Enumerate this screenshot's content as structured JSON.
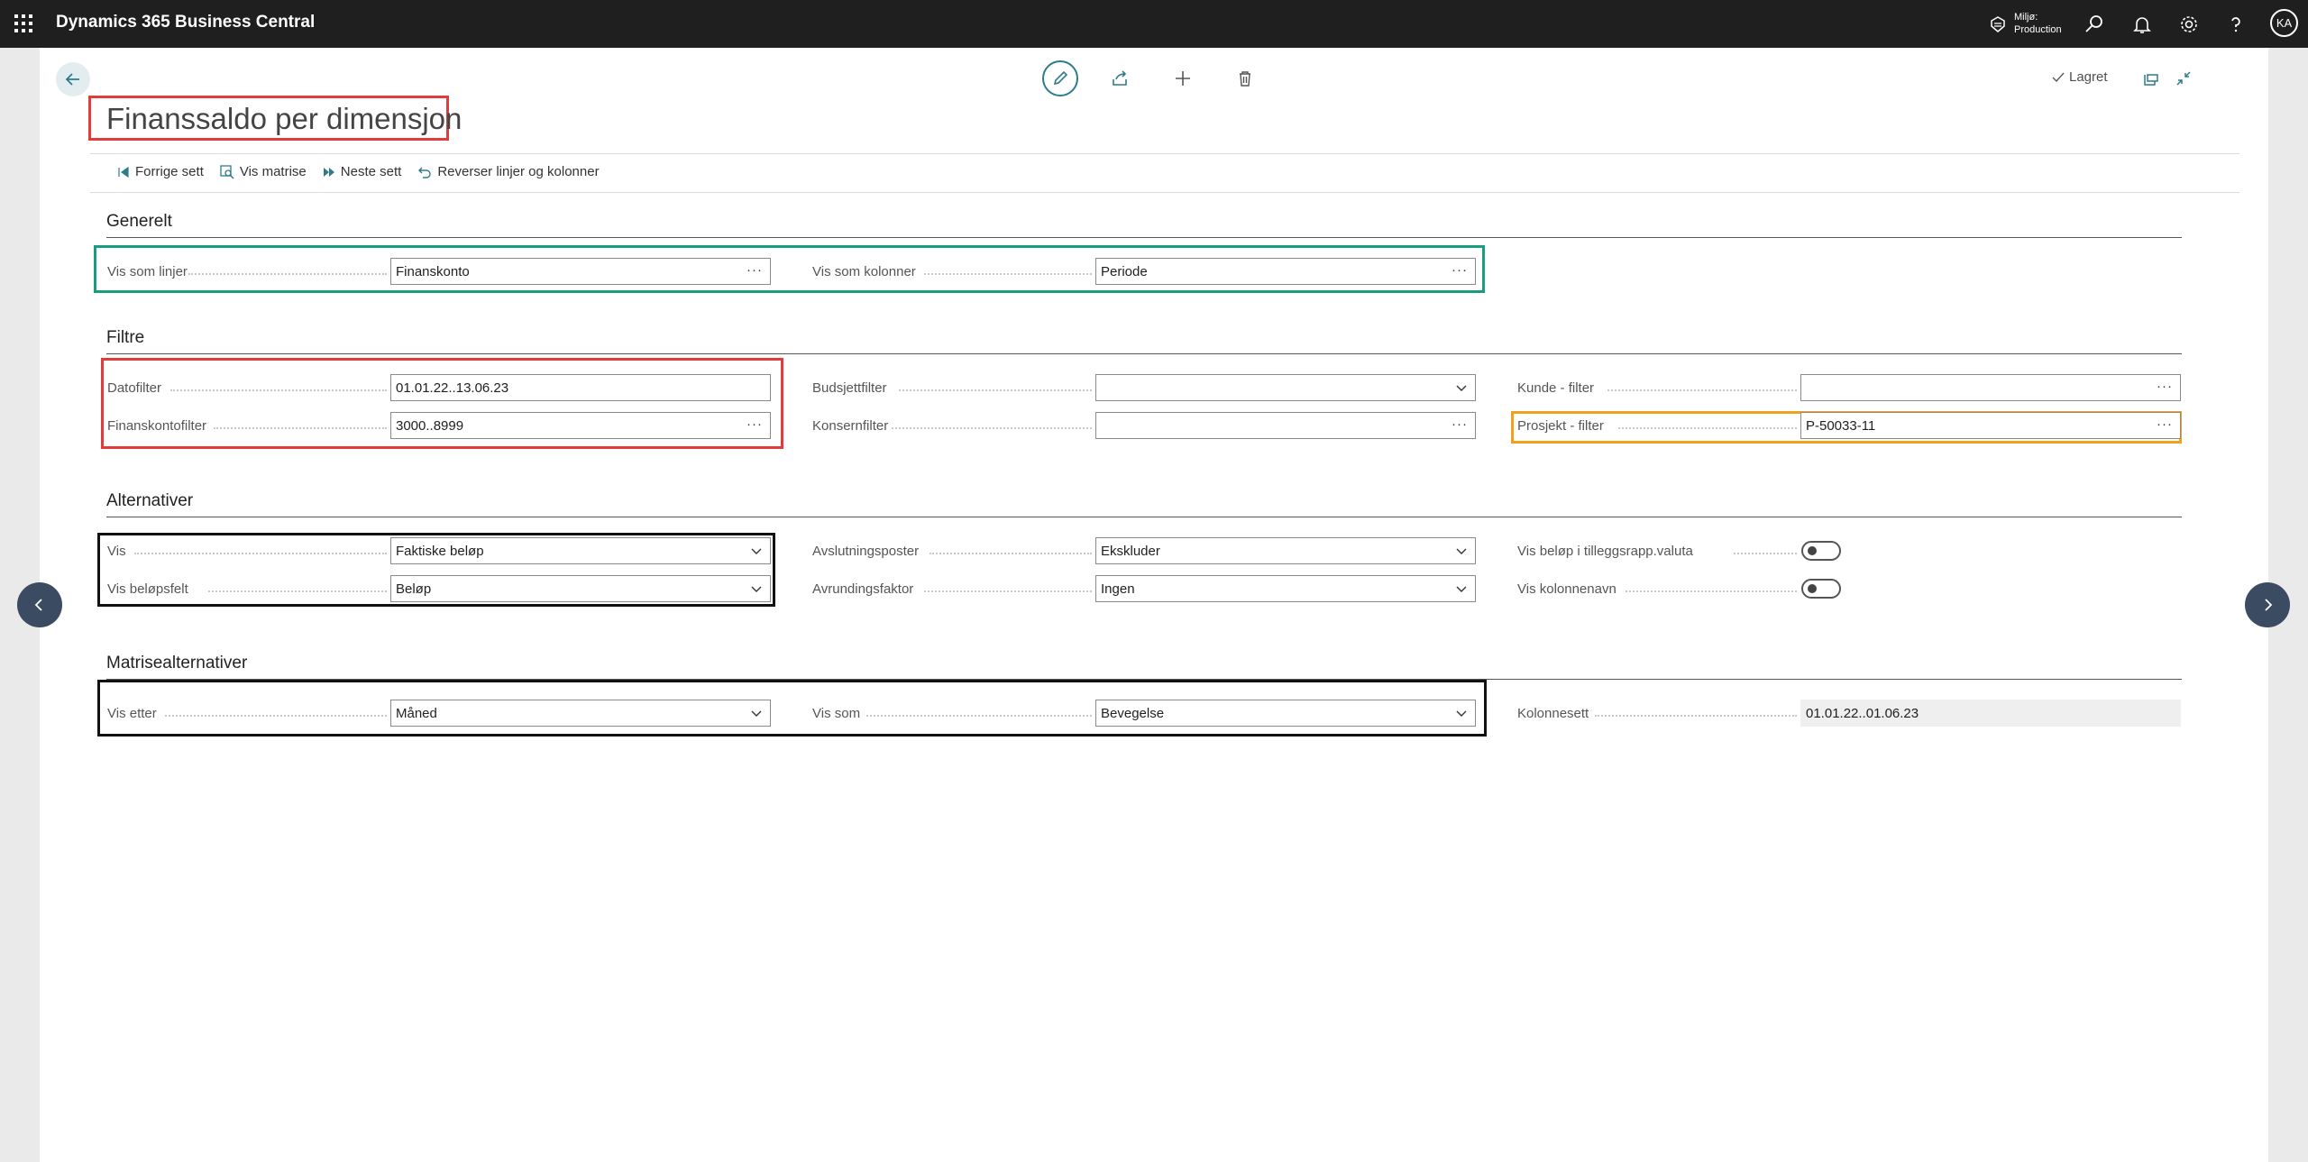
{
  "topbar": {
    "app_title": "Dynamics 365 Business Central",
    "env_line1": "Miljø:",
    "env_line2": "Production",
    "avatar_initials": "KA"
  },
  "header": {
    "saved_label": "Lagret",
    "page_title": "Finanssaldo per dimensjon"
  },
  "actions": {
    "previous_set": "Forrige sett",
    "show_matrix": "Vis matrise",
    "next_set": "Neste sett",
    "reverse": "Reverser linjer og kolonner"
  },
  "general": {
    "title": "Generelt",
    "show_as_lines_label": "Vis som linjer",
    "show_as_lines_value": "Finanskonto",
    "show_as_columns_label": "Vis som kolonner",
    "show_as_columns_value": "Periode"
  },
  "filters": {
    "title": "Filtre",
    "date_filter_label": "Datofilter",
    "date_filter_value": "01.01.22..13.06.23",
    "gl_account_filter_label": "Finanskontofilter",
    "gl_account_filter_value": "3000..8999",
    "budget_filter_label": "Budsjettfilter",
    "budget_filter_value": "",
    "consolidation_filter_label": "Konsernfilter",
    "consolidation_filter_value": "",
    "customer_filter_label": "Kunde  - filter",
    "customer_filter_value": "",
    "project_filter_label": "Prosjekt  - filter",
    "project_filter_value": "P-50033-11"
  },
  "options": {
    "title": "Alternativer",
    "show_label": "Vis",
    "show_value": "Faktiske beløp",
    "amount_field_label": "Vis beløpsfelt",
    "amount_field_value": "Beløp",
    "closing_entries_label": "Avslutningsposter",
    "closing_entries_value": "Ekskluder",
    "rounding_factor_label": "Avrundingsfaktor",
    "rounding_factor_value": "Ingen",
    "addl_currency_label": "Vis beløp i tilleggsrapp.valuta",
    "addl_currency_on": false,
    "column_name_label": "Vis kolonnenavn",
    "column_name_on": false
  },
  "matrix": {
    "title": "Matrisealternativer",
    "view_by_label": "Vis etter",
    "view_by_value": "Måned",
    "view_as_label": "Vis som",
    "view_as_value": "Bevegelse",
    "column_set_label": "Kolonnesett",
    "column_set_value": "01.01.22..01.06.23"
  },
  "colors": {
    "topbar": "#1f1f1f",
    "accent": "#2d7c8c",
    "highlight_green": "#1a9c7e",
    "highlight_red": "#e03c3c",
    "highlight_orange": "#f0a21e",
    "highlight_black": "#111111"
  }
}
